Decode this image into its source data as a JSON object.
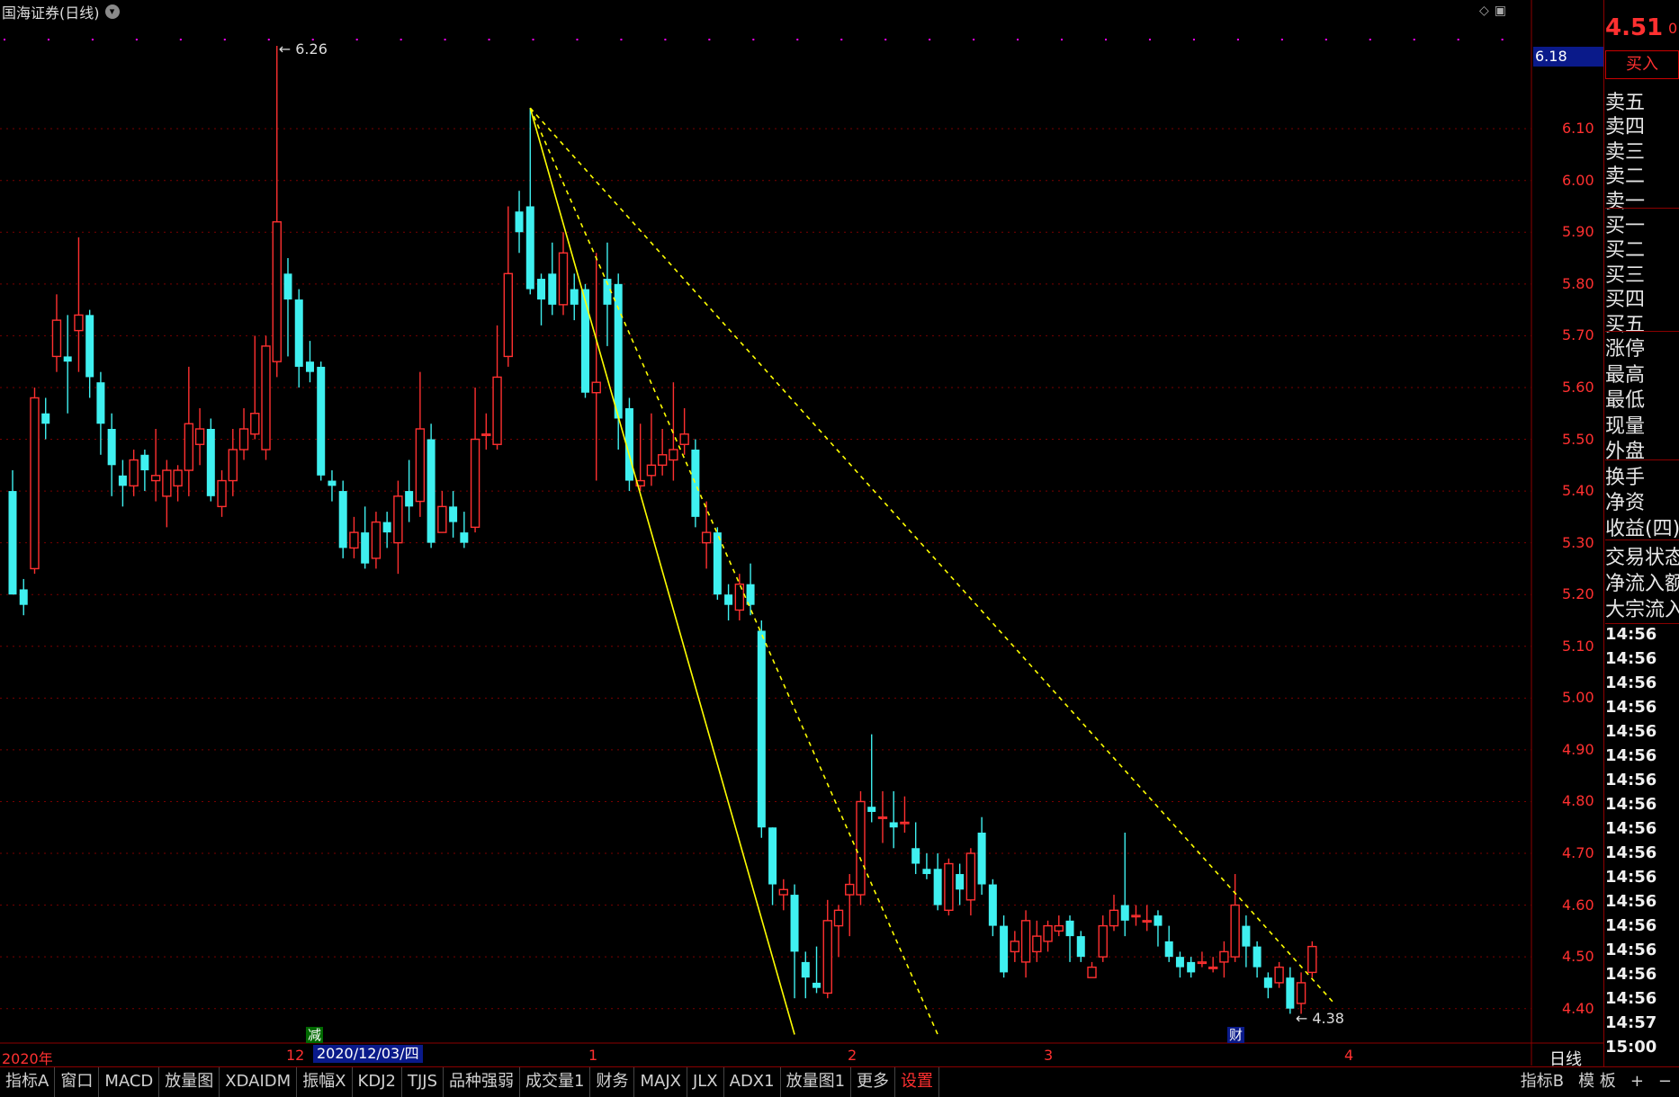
{
  "window": {
    "title": "国海证券(日线)"
  },
  "right_panel": {
    "price": "4.51",
    "price_suffix": "0",
    "buy_button": "买入",
    "order_book": [
      "卖五",
      "卖四",
      "卖三",
      "卖二",
      "卖一",
      "买一",
      "买二",
      "买三",
      "买四",
      "买五"
    ],
    "stats": [
      "涨停",
      "最高",
      "最低",
      "现量",
      "外盘"
    ],
    "stats2": [
      "换手",
      "净资",
      "收益(四)"
    ],
    "stats3": [
      "交易状态",
      "净流入额",
      "大宗流入"
    ],
    "ticks": [
      "14:56",
      "14:56",
      "14:56",
      "14:56",
      "14:56",
      "14:56",
      "14:56",
      "14:56",
      "14:56",
      "14:56",
      "14:56",
      "14:56",
      "14:56",
      "14:56",
      "14:56",
      "14:56",
      "14:57",
      "15:00"
    ]
  },
  "current_price_label": "6.18",
  "annotations": {
    "high": "6.26",
    "low": "4.38"
  },
  "date_axis": {
    "labels": [
      "2020年",
      "12",
      "1",
      "2",
      "3",
      "4"
    ],
    "highlight": "2020/12/03/四",
    "badge_green": "减",
    "badge_blue": "财",
    "period": "日线"
  },
  "tabs": [
    "指标A",
    "窗口",
    "MACD",
    "放量图",
    "XDAIDM",
    "振幅X",
    "KDJ2",
    "TJJS",
    "品种强弱",
    "成交量1",
    "财务",
    "MAJX",
    "JLX",
    "ADX1",
    "放量图1",
    "更多",
    "设置"
  ],
  "tabs_right": [
    "指标B",
    "模 板",
    "+",
    "−"
  ],
  "colors": {
    "up": "#ff3030",
    "down": "#3ff0f0",
    "grid": "#7a0000",
    "trend": "#ffff00"
  },
  "chart_data": {
    "type": "candlestick",
    "ylim": [
      4.33,
      6.3
    ],
    "yticks": [
      6.1,
      6.0,
      5.9,
      5.8,
      5.7,
      5.6,
      5.5,
      5.4,
      5.3,
      5.2,
      5.1,
      5.0,
      4.9,
      4.8,
      4.7,
      4.6,
      4.5,
      4.4
    ],
    "candles": [
      [
        5.4,
        5.2,
        5.21,
        5.44
      ],
      [
        5.21,
        5.18,
        5.16,
        5.23
      ],
      [
        5.25,
        5.58,
        5.24,
        5.6
      ],
      [
        5.55,
        5.53,
        5.5,
        5.58
      ],
      [
        5.66,
        5.73,
        5.63,
        5.78
      ],
      [
        5.66,
        5.65,
        5.55,
        5.74
      ],
      [
        5.71,
        5.74,
        5.63,
        5.89
      ],
      [
        5.74,
        5.62,
        5.58,
        5.75
      ],
      [
        5.61,
        5.53,
        5.47,
        5.63
      ],
      [
        5.52,
        5.45,
        5.39,
        5.55
      ],
      [
        5.43,
        5.41,
        5.37,
        5.46
      ],
      [
        5.41,
        5.46,
        5.39,
        5.48
      ],
      [
        5.47,
        5.44,
        5.4,
        5.48
      ],
      [
        5.42,
        5.43,
        5.38,
        5.52
      ],
      [
        5.39,
        5.44,
        5.33,
        5.46
      ],
      [
        5.41,
        5.44,
        5.38,
        5.45
      ],
      [
        5.44,
        5.53,
        5.39,
        5.64
      ],
      [
        5.49,
        5.52,
        5.45,
        5.56
      ],
      [
        5.52,
        5.39,
        5.38,
        5.54
      ],
      [
        5.37,
        5.42,
        5.35,
        5.44
      ],
      [
        5.42,
        5.48,
        5.39,
        5.52
      ],
      [
        5.48,
        5.52,
        5.46,
        5.56
      ],
      [
        5.51,
        5.55,
        5.5,
        5.7
      ],
      [
        5.48,
        5.68,
        5.46,
        5.7
      ],
      [
        5.65,
        5.92,
        5.62,
        6.26
      ],
      [
        5.82,
        5.77,
        5.66,
        5.85
      ],
      [
        5.77,
        5.64,
        5.6,
        5.79
      ],
      [
        5.65,
        5.63,
        5.61,
        5.69
      ],
      [
        5.64,
        5.43,
        5.42,
        5.65
      ],
      [
        5.42,
        5.41,
        5.38,
        5.44
      ],
      [
        5.4,
        5.29,
        5.27,
        5.42
      ],
      [
        5.29,
        5.32,
        5.27,
        5.35
      ],
      [
        5.32,
        5.26,
        5.25,
        5.37
      ],
      [
        5.27,
        5.34,
        5.25,
        5.36
      ],
      [
        5.34,
        5.32,
        5.29,
        5.36
      ],
      [
        5.3,
        5.39,
        5.24,
        5.42
      ],
      [
        5.4,
        5.37,
        5.34,
        5.46
      ],
      [
        5.38,
        5.52,
        5.35,
        5.63
      ],
      [
        5.5,
        5.3,
        5.29,
        5.53
      ],
      [
        5.32,
        5.37,
        5.32,
        5.4
      ],
      [
        5.37,
        5.34,
        5.31,
        5.4
      ],
      [
        5.32,
        5.3,
        5.29,
        5.36
      ],
      [
        5.33,
        5.5,
        5.32,
        5.6
      ],
      [
        5.51,
        5.51,
        5.48,
        5.55
      ],
      [
        5.49,
        5.62,
        5.48,
        5.72
      ],
      [
        5.66,
        5.82,
        5.64,
        5.95
      ],
      [
        5.94,
        5.9,
        5.86,
        5.98
      ],
      [
        5.95,
        5.79,
        5.78,
        6.14
      ],
      [
        5.81,
        5.77,
        5.72,
        5.82
      ],
      [
        5.82,
        5.76,
        5.74,
        5.88
      ],
      [
        5.76,
        5.86,
        5.74,
        5.9
      ],
      [
        5.79,
        5.76,
        5.73,
        5.82
      ],
      [
        5.79,
        5.59,
        5.58,
        5.8
      ],
      [
        5.59,
        5.61,
        5.42,
        5.86
      ],
      [
        5.81,
        5.76,
        5.68,
        5.88
      ],
      [
        5.8,
        5.54,
        5.48,
        5.82
      ],
      [
        5.56,
        5.42,
        5.4,
        5.58
      ],
      [
        5.41,
        5.42,
        5.4,
        5.53
      ],
      [
        5.43,
        5.45,
        5.41,
        5.55
      ],
      [
        5.45,
        5.47,
        5.43,
        5.52
      ],
      [
        5.46,
        5.48,
        5.42,
        5.61
      ],
      [
        5.49,
        5.51,
        5.47,
        5.56
      ],
      [
        5.48,
        5.35,
        5.33,
        5.5
      ],
      [
        5.3,
        5.32,
        5.25,
        5.38
      ],
      [
        5.32,
        5.2,
        5.19,
        5.33
      ],
      [
        5.2,
        5.18,
        5.15,
        5.22
      ],
      [
        5.17,
        5.22,
        5.15,
        5.24
      ],
      [
        5.22,
        5.18,
        5.16,
        5.26
      ],
      [
        5.13,
        4.75,
        4.73,
        5.15
      ],
      [
        4.75,
        4.64,
        4.6,
        4.75
      ],
      [
        4.62,
        4.63,
        4.59,
        4.65
      ],
      [
        4.62,
        4.51,
        4.42,
        4.64
      ],
      [
        4.49,
        4.46,
        4.42,
        4.51
      ],
      [
        4.45,
        4.44,
        4.43,
        4.52
      ],
      [
        4.43,
        4.57,
        4.42,
        4.61
      ],
      [
        4.56,
        4.59,
        4.5,
        4.6
      ],
      [
        4.62,
        4.64,
        4.54,
        4.66
      ],
      [
        4.62,
        4.8,
        4.6,
        4.82
      ],
      [
        4.79,
        4.78,
        4.76,
        4.93
      ],
      [
        4.77,
        4.77,
        4.72,
        4.82
      ],
      [
        4.76,
        4.75,
        4.71,
        4.82
      ],
      [
        4.76,
        4.76,
        4.74,
        4.81
      ],
      [
        4.71,
        4.68,
        4.66,
        4.76
      ],
      [
        4.67,
        4.66,
        4.65,
        4.7
      ],
      [
        4.67,
        4.6,
        4.59,
        4.7
      ],
      [
        4.59,
        4.68,
        4.58,
        4.69
      ],
      [
        4.66,
        4.63,
        4.6,
        4.68
      ],
      [
        4.61,
        4.7,
        4.58,
        4.71
      ],
      [
        4.74,
        4.64,
        4.62,
        4.77
      ],
      [
        4.64,
        4.56,
        4.54,
        4.65
      ],
      [
        4.56,
        4.47,
        4.46,
        4.58
      ],
      [
        4.51,
        4.53,
        4.49,
        4.55
      ],
      [
        4.49,
        4.57,
        4.46,
        4.59
      ],
      [
        4.51,
        4.54,
        4.49,
        4.57
      ],
      [
        4.53,
        4.56,
        4.51,
        4.57
      ],
      [
        4.55,
        4.56,
        4.54,
        4.58
      ],
      [
        4.57,
        4.54,
        4.49,
        4.58
      ],
      [
        4.54,
        4.5,
        4.49,
        4.55
      ],
      [
        4.46,
        4.48,
        4.46,
        4.49
      ],
      [
        4.5,
        4.56,
        4.49,
        4.58
      ],
      [
        4.56,
        4.59,
        4.55,
        4.62
      ],
      [
        4.6,
        4.57,
        4.54,
        4.74
      ],
      [
        4.58,
        4.58,
        4.56,
        4.6
      ],
      [
        4.57,
        4.57,
        4.55,
        4.6
      ],
      [
        4.58,
        4.56,
        4.52,
        4.59
      ],
      [
        4.53,
        4.5,
        4.49,
        4.56
      ],
      [
        4.5,
        4.48,
        4.46,
        4.51
      ],
      [
        4.49,
        4.47,
        4.46,
        4.5
      ],
      [
        4.49,
        4.49,
        4.48,
        4.51
      ],
      [
        4.48,
        4.48,
        4.47,
        4.5
      ],
      [
        4.49,
        4.51,
        4.46,
        4.53
      ],
      [
        4.5,
        4.6,
        4.49,
        4.66
      ],
      [
        4.56,
        4.52,
        4.48,
        4.58
      ],
      [
        4.52,
        4.48,
        4.46,
        4.53
      ],
      [
        4.46,
        4.44,
        4.42,
        4.47
      ],
      [
        4.45,
        4.48,
        4.44,
        4.49
      ],
      [
        4.46,
        4.4,
        4.39,
        4.48
      ],
      [
        4.41,
        4.45,
        4.39,
        4.47
      ],
      [
        4.47,
        4.52,
        4.46,
        4.53
      ]
    ],
    "trendlines": [
      {
        "from": [
          47,
          6.14
        ],
        "to": [
          71,
          4.35
        ],
        "style": "solid"
      },
      {
        "from": [
          47,
          6.14
        ],
        "to": [
          84,
          4.35
        ],
        "style": "dashed"
      },
      {
        "from": [
          47,
          6.14
        ],
        "to": [
          120,
          4.41
        ],
        "style": "dashed"
      }
    ]
  }
}
